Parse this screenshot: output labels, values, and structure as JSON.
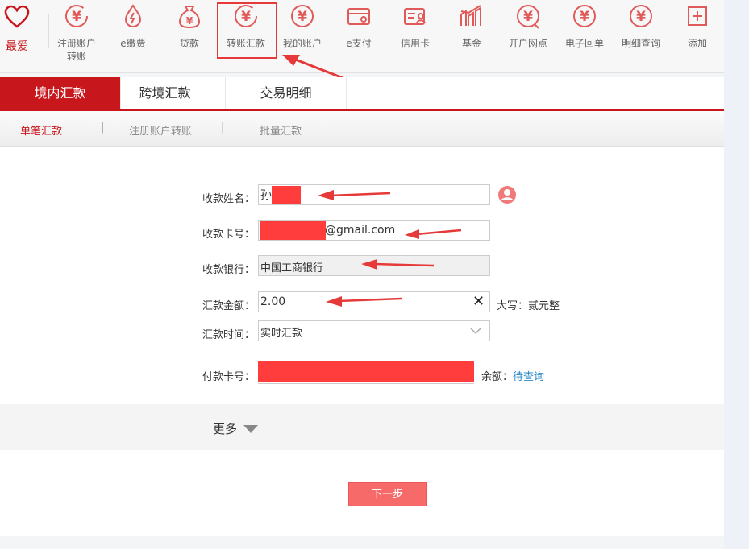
{
  "toolbar": {
    "favorites": "最爱",
    "items": [
      {
        "label": "注册账户\n转账",
        "icon": "yen-refresh-icon"
      },
      {
        "label": "e缴费",
        "icon": "water-drop-icon"
      },
      {
        "label": "贷款",
        "icon": "money-bag-icon"
      },
      {
        "label": "转账汇款",
        "icon": "yen-refresh-icon"
      },
      {
        "label": "我的账户",
        "icon": "yen-circle-icon"
      },
      {
        "label": "e支付",
        "icon": "wallet-card-icon"
      },
      {
        "label": "信用卡",
        "icon": "credit-card-user-icon"
      },
      {
        "label": "基金",
        "icon": "bar-chart-icon"
      },
      {
        "label": "开户网点",
        "icon": "yen-location-icon"
      },
      {
        "label": "电子回单",
        "icon": "yen-circle-icon"
      },
      {
        "label": "明细查询",
        "icon": "yen-circle-icon"
      },
      {
        "label": "添加",
        "icon": "plus-box-icon"
      }
    ]
  },
  "tabs": [
    "境内汇款",
    "跨境汇款",
    "交易明细"
  ],
  "subtabs": [
    "单笔汇款",
    "注册账户转账",
    "批量汇款"
  ],
  "form": {
    "payee_name_label": "收款姓名：",
    "payee_name_value": "孙",
    "payee_card_label": "收款卡号：",
    "payee_card_value": "@gmail.com",
    "payee_bank_label": "收款银行：",
    "payee_bank_value": "中国工商银行",
    "amount_label": "汇款金额：",
    "amount_value": "2.00",
    "amount_upper_label": "大写：",
    "amount_upper_value": "贰元整",
    "time_label": "汇款时间：",
    "time_value": "实时汇款",
    "payer_card_label": "付款卡号：",
    "balance_label": "余额：",
    "balance_link": "待查询"
  },
  "more_label": "更多",
  "next_button": "下一步",
  "colors": {
    "brand": "#c8161d",
    "annotation": "#e63939",
    "link": "#2a8ac8"
  }
}
